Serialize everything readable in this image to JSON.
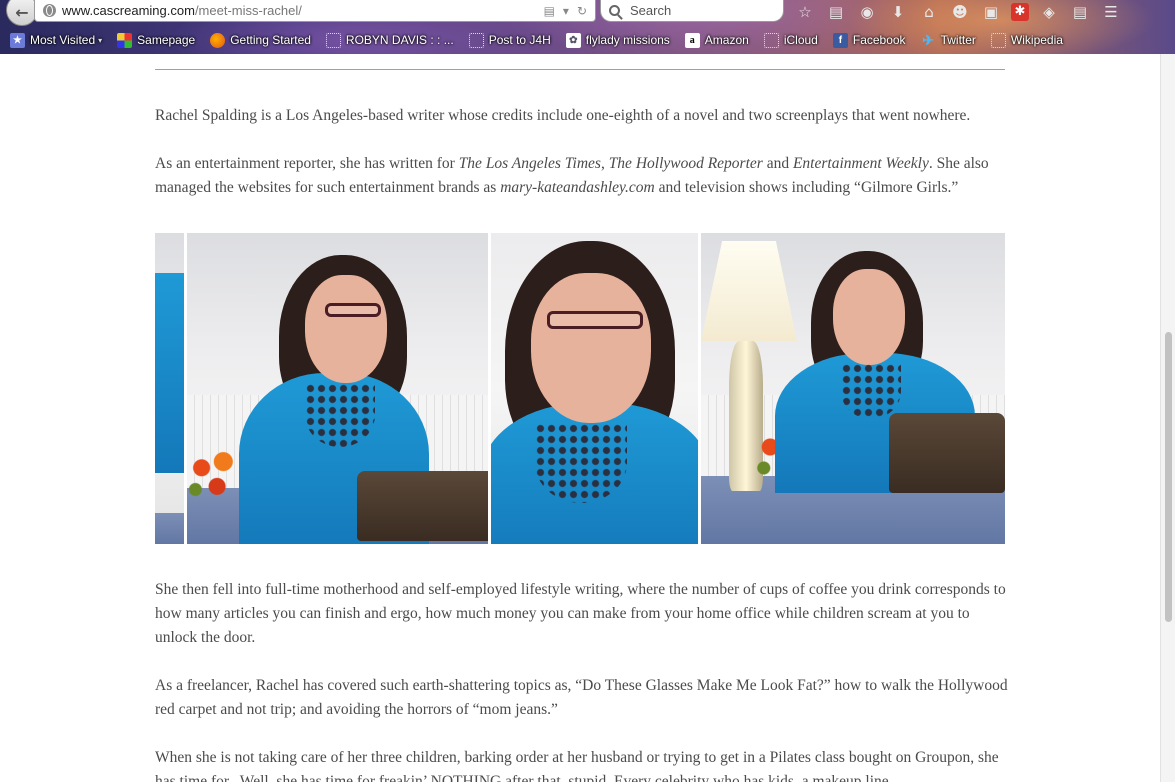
{
  "browser": {
    "url_domain": "www.cascreaming.com",
    "url_path": "/meet-miss-rachel/",
    "search_placeholder": "Search",
    "bookmarks": [
      {
        "label": "Most Visited",
        "icon": "most-visited-icon",
        "glyph": "★",
        "style": "ico-star",
        "dropdown": true
      },
      {
        "label": "Samepage",
        "icon": "samepage-icon",
        "glyph": "",
        "style": "ico-same"
      },
      {
        "label": "Getting Started",
        "icon": "firefox-icon",
        "glyph": "",
        "style": "ico-fox"
      },
      {
        "label": "ROBYN DAVIS : : ...",
        "icon": "page-icon",
        "glyph": "",
        "style": "ico-dot"
      },
      {
        "label": "Post to J4H",
        "icon": "page-icon",
        "glyph": "",
        "style": "ico-dot"
      },
      {
        "label": "flylady missions",
        "icon": "flylady-icon",
        "glyph": "✿",
        "style": "ico-fly"
      },
      {
        "label": "Amazon",
        "icon": "amazon-icon",
        "glyph": "a",
        "style": "ico-amz"
      },
      {
        "label": "iCloud",
        "icon": "page-icon",
        "glyph": "",
        "style": "ico-dot"
      },
      {
        "label": "Facebook",
        "icon": "facebook-icon",
        "glyph": "f",
        "style": "ico-fb"
      },
      {
        "label": "Twitter",
        "icon": "twitter-icon",
        "glyph": "✈",
        "style": "ico-tw"
      },
      {
        "label": "Wikipedia",
        "icon": "page-icon",
        "glyph": "",
        "style": "ico-dot"
      }
    ]
  },
  "article": {
    "p1": "Rachel Spalding is a Los Angeles-based writer whose credits include one-eighth of a novel and two screenplays that went nowhere.",
    "p2_a": "As an entertainment reporter, she has written for ",
    "p2_la": "The Los Angeles Times",
    "p2_sep": ", ",
    "p2_hr": "The Hollywood Reporter",
    "p2_and": " and ",
    "p2_ew": "Entertainment Weekly",
    "p2_b": ". She also managed the websites for such entertainment brands as ",
    "p2_mk": "mary-kateandashley.com",
    "p2_c": " and television shows including “Gilmore Girls.”",
    "p3": "She then fell into full-time motherhood and self-employed lifestyle writing, where the number of cups of coffee you drink corresponds to how many articles you can finish and ergo, how much money you can make from your home office while children scream at you to unlock the door.",
    "p4": "As a freelancer, Rachel has covered such earth-shattering topics as, “Do These Glasses Make Me Look Fat?” how to walk the Hollywood red carpet and not trip; and avoiding the horrors of “mom jeans.”",
    "p5": "When she is not taking care of her three children, barking order at her husband or trying to get in a Pilates class bought on Groupon, she has time for...Well, she has time for freakin’ NOTHING after that, stupid. Every celebrity who has kids, a makeup line"
  },
  "colors": {
    "rule": "#a6a86a",
    "text": "#4b4b4b",
    "blouse": "#1a8ccc"
  }
}
